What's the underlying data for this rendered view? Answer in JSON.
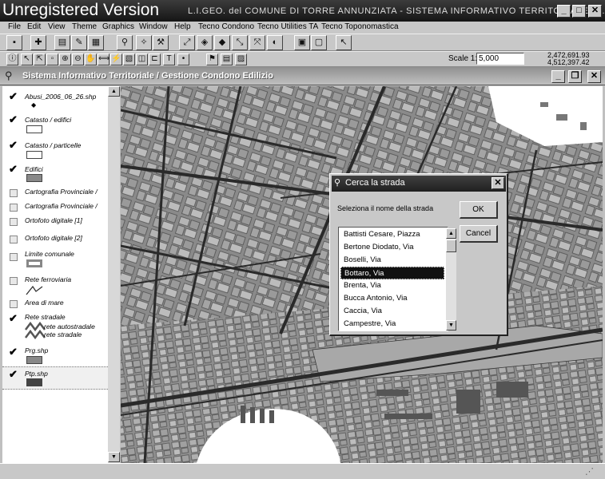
{
  "titlebar": {
    "watermark": "Unregistered Version",
    "title": "L.I.GEO. del COMUNE DI TORRE ANNUNZIATA  -  SISTEMA INFORMATIVO TERRITORIALE [s..."
  },
  "menu": [
    "File",
    "Edit",
    "View",
    "Theme",
    "Graphics",
    "Window",
    "Help",
    "Tecno Condono",
    "Tecno Utilities TA",
    "Tecno Toponomastica"
  ],
  "toolbar2": {
    "scale_label": "Scale 1:",
    "scale_value": "5,000",
    "coord_x": "2,472,691.93",
    "coord_y": "4,512,397.42"
  },
  "document": {
    "title": "Sistema Informativo Territoriale / Gestione Condono Edilizio"
  },
  "toc": [
    {
      "name": "Abusi_2006_06_26.shp",
      "checked": true,
      "symbol": "dot"
    },
    {
      "name": "Catasto / edifici",
      "checked": true,
      "symbol": "box"
    },
    {
      "name": "Catasto / particelle",
      "checked": true,
      "symbol": "box"
    },
    {
      "name": "Edifici",
      "checked": true,
      "symbol": "gray"
    },
    {
      "name": "Cartografia Provinciale /",
      "checked": false,
      "symbol": "none"
    },
    {
      "name": "Cartografia Provinciale /",
      "checked": false,
      "symbol": "none"
    },
    {
      "name": "Ortofoto digitale [1]",
      "checked": false,
      "symbol": "none"
    },
    {
      "name": "Ortofoto digitale [2]",
      "checked": false,
      "symbol": "none"
    },
    {
      "name": "Limite comunale",
      "checked": false,
      "symbol": "thick"
    },
    {
      "name": "Rete ferroviaria",
      "checked": false,
      "symbol": "rail"
    },
    {
      "name": "Area di mare",
      "checked": false,
      "symbol": "none"
    },
    {
      "name": "Rete stradale",
      "checked": true,
      "symbol": "roads"
    },
    {
      "name": "Prg.shp",
      "checked": true,
      "symbol": "gray"
    },
    {
      "name": "Ptp.shp",
      "checked": true,
      "symbol": "dark"
    }
  ],
  "toc_sublabels": [
    "rete autostradale",
    "rete stradale"
  ],
  "dialog": {
    "title": "Cerca la strada",
    "prompt": "Seleziona il nome della strada",
    "ok": "OK",
    "cancel": "Cancel",
    "streets": [
      "Battisti Cesare, Piazza",
      "Bertone Diodato, Via",
      "Boselli, Via",
      "Bottaro, Via",
      "Brenta, Via",
      "Bucca Antonio, Via",
      "Caccia, Via",
      "Campestre, Via"
    ],
    "selected_index": 3
  },
  "colors": {
    "titlebar": "#202020",
    "selection": "#111111",
    "map_bg": "#5a5a5a"
  }
}
